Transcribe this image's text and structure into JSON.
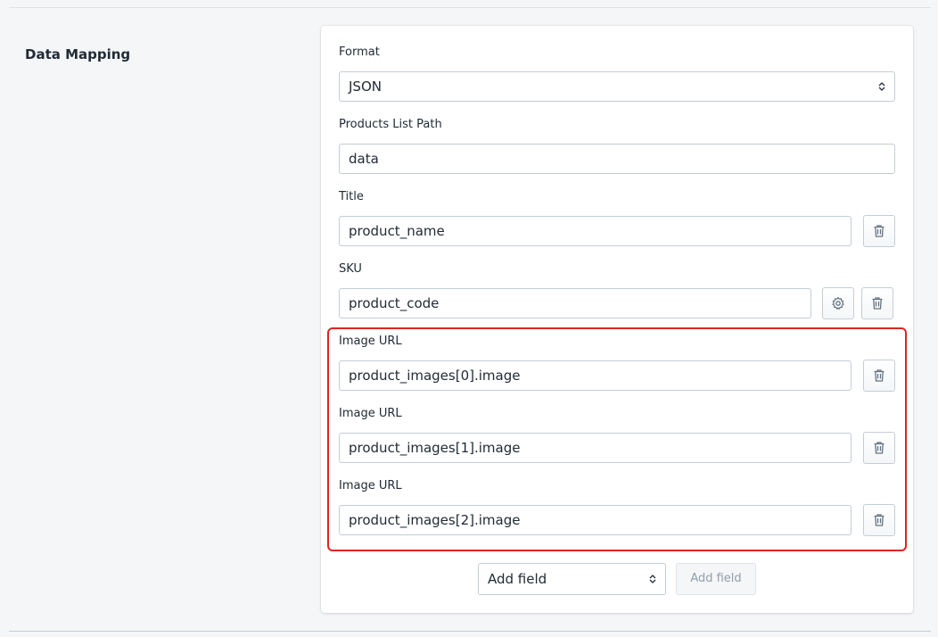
{
  "section": {
    "title": "Data Mapping"
  },
  "format": {
    "label": "Format",
    "value": "JSON"
  },
  "products_path": {
    "label": "Products List Path",
    "value": "data"
  },
  "title_field": {
    "label": "Title",
    "value": "product_name"
  },
  "sku_field": {
    "label": "SKU",
    "value": "product_code"
  },
  "image_fields": [
    {
      "label": "Image URL",
      "value": "product_images[0].image"
    },
    {
      "label": "Image URL",
      "value": "product_images[1].image"
    },
    {
      "label": "Image URL",
      "value": "product_images[2].image"
    }
  ],
  "add_field": {
    "select_value": "Add field",
    "button_label": "Add field"
  },
  "colors": {
    "highlight": "#e02424",
    "border": "#c4cdd5",
    "icon": "#637381"
  },
  "icons": {
    "delete": "trash-icon",
    "settings": "gear-icon",
    "select": "select-arrows-icon"
  }
}
